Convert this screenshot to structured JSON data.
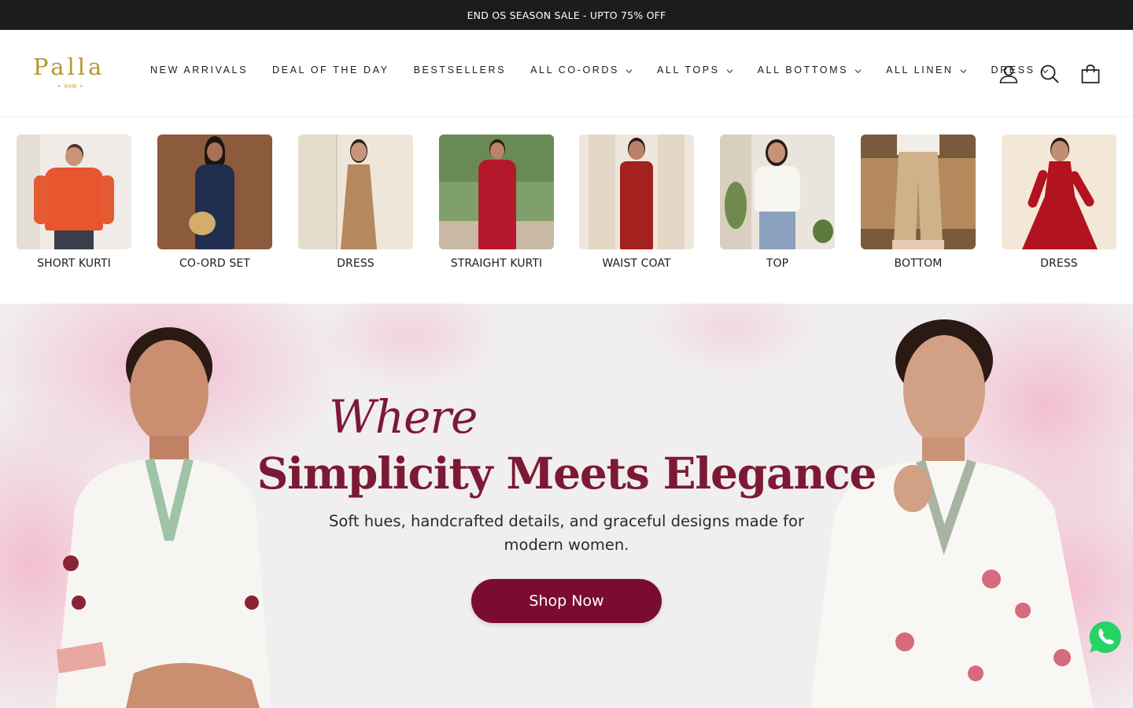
{
  "announcement": {
    "text": "END OS SEASON SALE - UPTO 75% OFF"
  },
  "brand": {
    "name": "PALLA",
    "tagline": "• पल्ला •",
    "color": "#b8962f"
  },
  "nav": {
    "items": [
      {
        "label": "NEW ARRIVALS",
        "dropdown": false
      },
      {
        "label": "DEAL OF THE DAY",
        "dropdown": false
      },
      {
        "label": "BESTSELLERS",
        "dropdown": false
      },
      {
        "label": "ALL CO-ORDS",
        "dropdown": true
      },
      {
        "label": "ALL TOPS",
        "dropdown": true
      },
      {
        "label": "ALL BOTTOMS",
        "dropdown": true
      },
      {
        "label": "ALL LINEN",
        "dropdown": true
      },
      {
        "label": "DRESS",
        "dropdown": true
      }
    ],
    "icons": [
      "account-icon",
      "search-icon",
      "cart-icon"
    ]
  },
  "categories": [
    {
      "label": "SHORT KURTI",
      "garment": "#e8552e",
      "backdrop": "#f0ebe6"
    },
    {
      "label": "CO-ORD SET",
      "garment": "#1f2d4e",
      "backdrop": "#8c5a3c"
    },
    {
      "label": "DRESS",
      "garment": "#b58860",
      "backdrop": "#efe6da"
    },
    {
      "label": "STRAIGHT KURTI",
      "garment": "#b5182a",
      "backdrop": "#7fa06a"
    },
    {
      "label": "WAIST COAT",
      "garment": "#a3211f",
      "backdrop": "#eee6dc"
    },
    {
      "label": "TOP",
      "garment": "#f7f5f0",
      "backdrop": "#e9e4dc"
    },
    {
      "label": "BOTTOM",
      "garment": "#cfb28a",
      "backdrop": "#7a5a3c"
    },
    {
      "label": "DRESS",
      "garment": "#b3121f",
      "backdrop": "#f3e8d7"
    }
  ],
  "hero": {
    "script": "Where",
    "headline": "Simplicity Meets Elegance",
    "description": "Soft hues, handcrafted details, and graceful designs made for modern women.",
    "cta": "Shop Now",
    "accent": "#7a0c2f"
  },
  "floating": {
    "whatsapp": "whatsapp-icon",
    "color": "#25d366"
  }
}
